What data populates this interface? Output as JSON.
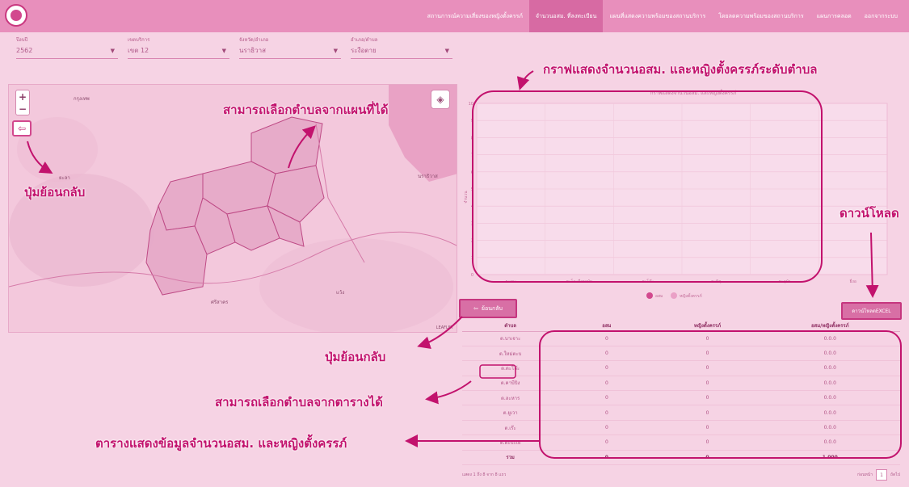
{
  "nav": {
    "logo_icon": "moph-logo-icon",
    "items": [
      {
        "label": "สถานการณ์ความเสี่ยงของหญิงตั้งครรภ์",
        "active": false
      },
      {
        "label": "จำนวนอสม. ที่ลงทะเบียน",
        "active": true
      },
      {
        "label": "แผนที่แสดงความพร้อมของสถานบริการ",
        "active": false
      },
      {
        "label": "โดยลดความพร้อมของสถานบริการ",
        "active": false
      },
      {
        "label": "แผนการคลอด",
        "active": false
      },
      {
        "label": "ออกจากระบบ",
        "active": false
      }
    ]
  },
  "filters": [
    {
      "label": "ปีงบปี",
      "value": "2562"
    },
    {
      "label": "เขตบริการ",
      "value": "เขต 12"
    },
    {
      "label": "จังหวัด/อำเภอ",
      "value": "นราธิวาส"
    },
    {
      "label": "อำเภอ/ตำบล",
      "value": "ระงือตาย"
    }
  ],
  "map": {
    "places": [
      "กรุงเทพ",
      "ยะลา",
      "นราธิวาส",
      "ศรีสาคร",
      "แว้ง"
    ],
    "attribution": "LEAFLET",
    "zoom_in": "+",
    "zoom_out": "−",
    "back_icon": "arrow-left-icon",
    "layers_icon": "layers-icon"
  },
  "chart_data": {
    "type": "bar",
    "title": "กราฟแสดงจำนวนอสม. และหญิงตั้งครรภ์",
    "ylabel": "จำนวน",
    "yticks": [
      "0",
      "1",
      "2",
      "3",
      "4",
      "5",
      "6",
      "7",
      "8",
      "9",
      "10"
    ],
    "ylim": [
      0,
      10
    ],
    "grid": true,
    "categories": [
      "ระงาะ",
      "ตะโละดือรามัน",
      "ตะโล๊ะ",
      "ตะบิตุ",
      "ตะลุบัว",
      "ยี่งอ"
    ],
    "series": [
      {
        "name": "อสม",
        "values": [
          0,
          0,
          0,
          0,
          0,
          0
        ],
        "color": "#d2488e"
      },
      {
        "name": "หญิงตั้งครรภ์",
        "values": [
          0,
          0,
          0,
          0,
          0,
          0
        ],
        "color": "#eaa0c6"
      }
    ],
    "legend_position": "bottom"
  },
  "table": {
    "back_label": "ย้อนกลับ",
    "back_icon": "arrow-left-icon",
    "excel_label": "ดาวน์โหลดEXCEL",
    "headers": [
      "ตำบล",
      "อสม",
      "หญิงตั้งครรภ์",
      "อสม/หญิงตั้งครรภ์"
    ],
    "rows": [
      [
        "ต.บาเจาะ",
        "0",
        "0",
        "0.0.0"
      ],
      [
        "ต.ใหม่ตะบ",
        "0",
        "0",
        "0.0.0"
      ],
      [
        "ต.ตะโล๊ะ",
        "0",
        "0",
        "0.0.0"
      ],
      [
        "ต.คาบีบิง",
        "0",
        "0",
        "0.0.0"
      ],
      [
        "ต.ละหาร",
        "0",
        "0",
        "0.0.0"
      ],
      [
        "ต.ยูเวา",
        "0",
        "0",
        "0.0.0"
      ],
      [
        "ต.เร๊ะ",
        "0",
        "0",
        "0.0.0"
      ],
      [
        "ต.ตะบ้ะเย",
        "0",
        "0",
        "0.0.0"
      ]
    ],
    "total": [
      "รวม",
      "0",
      "0",
      "1.000"
    ],
    "footer_info": "แสดง 1 ถึง 8 จาก 8 แถว",
    "pager_prev": "ก่อนหน้า",
    "page": "1",
    "pager_next": "ถัดไป"
  },
  "annotations": {
    "chart_title": "กราฟแสดงจำนวนอสม. และหญิงตั้งครรภ์ระดับตำบล",
    "select_map": "สามารถเลือกตำบลจากแผนที่ได้",
    "back_map": "ปุ่มย้อนกลับ",
    "download": "ดาวน์โหลด",
    "back_table": "ปุ่มย้อนกลับ",
    "select_table": "สามารถเลือกตำบลจากตารางได้",
    "table_desc": "ตารางแสดงข้อมูลจำนวนอสม. และหญิงตั้งครรภ์"
  },
  "colors": {
    "accent": "#c2126d",
    "nav": "#e88fbc",
    "background": "#f6d3e4"
  }
}
